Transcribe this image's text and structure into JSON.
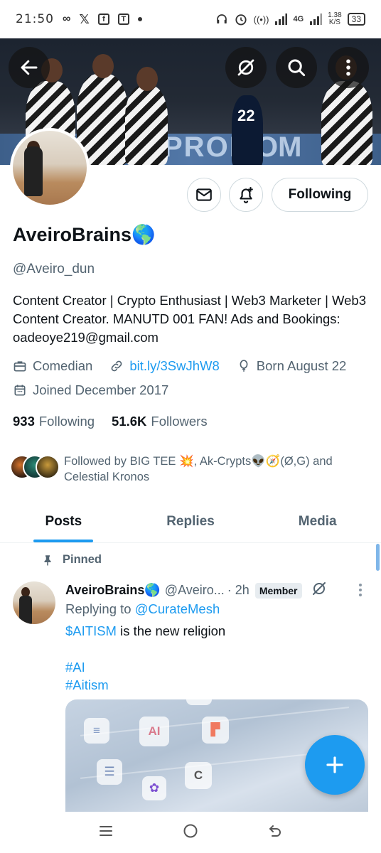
{
  "status_bar": {
    "time": "21:50",
    "network": "4G",
    "speed_value": "1.38",
    "speed_unit": "K/S",
    "battery": "33"
  },
  "profile": {
    "display_name": "AveiroBrains🌎",
    "handle": "@Aveiro_dun",
    "bio": "Content Creator | Crypto Enthusiast | Web3 Marketer | Web3 Content Creator. MANUTD 001 FAN! Ads and Bookings: oadeoye219@gmail.com",
    "category": "Comedian",
    "link": "bit.ly/3SwJhW8",
    "born": "Born August 22",
    "joined": "Joined December 2017",
    "following_count": "933",
    "following_label": "Following",
    "followers_count": "51.6K",
    "followers_label": "Followers",
    "followed_by": "Followed by BIG TEE 💥, Ak-Crypts👽🧭(Ø,G) and Celestial Kronos",
    "following_button": "Following"
  },
  "banner": {
    "text_left": "PROM",
    "text_right": "OM",
    "jersey_number": "22"
  },
  "tabs": [
    {
      "label": "Posts",
      "active": true
    },
    {
      "label": "Replies",
      "active": false
    },
    {
      "label": "Media",
      "active": false
    }
  ],
  "post": {
    "pinned_label": "Pinned",
    "author": "AveiroBrains🌎",
    "handle": "@Aveiro...",
    "time": "· 2h",
    "badge": "Member",
    "replying_prefix": "Replying to",
    "replying_to": "@CurateMesh",
    "cashtag": "$AITISM",
    "text": " is the new religion",
    "hashtags": [
      "#AI",
      "#Aitism"
    ],
    "image_keys": [
      "AI",
      "C"
    ]
  },
  "colors": {
    "accent": "#1d9bf0",
    "secondary_text": "#536471",
    "primary_text": "#0f1419",
    "border": "#cfd9de"
  }
}
